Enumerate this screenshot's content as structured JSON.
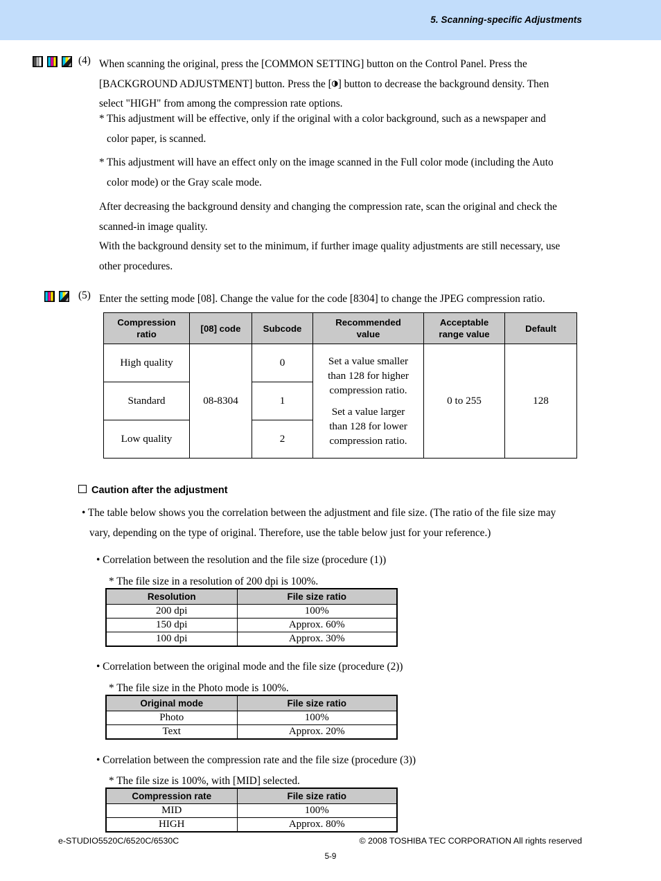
{
  "header": {
    "chapter_title": "5. Scanning-specific Adjustments",
    "band_color": "#c2ddfb"
  },
  "step4": {
    "number": "(4)",
    "icons": [
      "gray-bars-icon",
      "cmy-bars-icon",
      "half-split-icon"
    ],
    "lines": [
      "When scanning the original, press the [COMMON SETTING] button on the Control Panel.  Press the",
      "[BACKGROUND ADJUSTMENT] button.  Press the [",
      "] button to decrease the background density.  Then",
      "select \"HIGH\" from among the compression rate options."
    ],
    "line2_prefix": "[BACKGROUND ADJUSTMENT] button.  Press the [",
    "line2_suffix": "] button to decrease the background density.  Then",
    "line3": "select \"HIGH\" from among the compression rate options.",
    "note1": [
      "This adjustment will be effective, only if the original with a color background, such as a newspaper and",
      "color paper, is scanned."
    ],
    "note2": [
      "This adjustment will have an effect only on the image scanned in the Full color mode (including the Auto",
      "color mode) or the Gray scale mode."
    ],
    "tail": [
      "After decreasing the background density and changing the compression rate, scan the original and check the",
      "scanned-in image quality.",
      "With the background density set to the minimum, if further image quality adjustments are still necessary, use",
      "other procedures."
    ],
    "star": "*"
  },
  "step5": {
    "number": "(5)",
    "icons": [
      "cmy-bars-icon",
      "half-split-icon"
    ],
    "text": "Enter the setting mode [08]. Change the value for the code [8304] to change the JPEG compression ratio."
  },
  "main_table": {
    "headers": [
      "Compression\nratio",
      "[08] code",
      "Subcode",
      "Recommended\nvalue",
      "Acceptable\nrange value",
      "Default"
    ],
    "headers_split": [
      [
        "Compression",
        "ratio"
      ],
      [
        "[08] code",
        ""
      ],
      [
        "Subcode",
        ""
      ],
      [
        "Recommended",
        "value"
      ],
      [
        "Acceptable",
        "range value"
      ],
      [
        "Default",
        ""
      ]
    ],
    "rows": [
      {
        "ratio": "High quality",
        "subcode": "0"
      },
      {
        "ratio": "Standard",
        "subcode": "1"
      },
      {
        "ratio": "Low quality",
        "subcode": "2"
      }
    ],
    "code": "08-8304",
    "recommended": {
      "part1": [
        "Set a value smaller",
        "than 128 for higher",
        "compression ratio."
      ],
      "part2": [
        "Set a value larger",
        "than 128 for lower",
        "compression ratio."
      ]
    },
    "acceptable_range": "0 to 255",
    "default": "128",
    "header_bg": "#c9c9c9"
  },
  "caution": {
    "heading": "Caution after the adjustment",
    "bullet": [
      "• The table below shows you the correlation between the adjustment and file size.  (The ratio of the file size may",
      "vary, depending on the type of original.  Therefore, use the table below just for your reference.)"
    ]
  },
  "sections": [
    {
      "label": "• Correlation between the resolution and the file size (procedure (1))",
      "note": "* The file size in a resolution of 200 dpi is 100%.",
      "table": {
        "headers": [
          "Resolution",
          "File size ratio"
        ],
        "rows": [
          [
            "200 dpi",
            "100%"
          ],
          [
            "150 dpi",
            "Approx. 60%"
          ],
          [
            "100 dpi",
            "Approx. 30%"
          ]
        ]
      }
    },
    {
      "label": "• Correlation between the original mode and the file size (procedure (2))",
      "note": "* The file size in the Photo mode is 100%.",
      "table": {
        "headers": [
          "Original mode",
          "File size ratio"
        ],
        "rows": [
          [
            "Photo",
            "100%"
          ],
          [
            "Text",
            "Approx. 20%"
          ]
        ]
      }
    },
    {
      "label": "• Correlation between the compression rate and the file size (procedure (3))",
      "note": "* The file size is 100%, with [MID] selected.",
      "table": {
        "headers": [
          "Compression rate",
          "File size ratio"
        ],
        "rows": [
          [
            "MID",
            "100%"
          ],
          [
            "HIGH",
            "Approx. 80%"
          ]
        ]
      }
    }
  ],
  "footer": {
    "model": "e-STUDIO5520C/6520C/6530C",
    "copyright": "© 2008 TOSHIBA TEC CORPORATION All rights reserved",
    "page_number": "5-9"
  }
}
